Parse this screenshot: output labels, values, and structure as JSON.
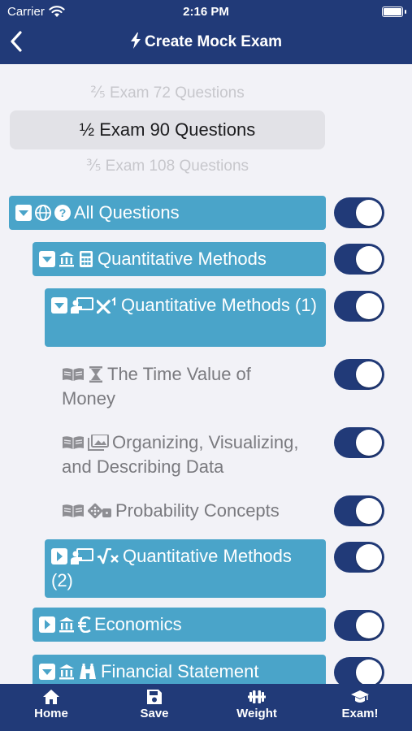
{
  "status": {
    "carrier": "Carrier",
    "time": "2:16 PM"
  },
  "header": {
    "title": "Create Mock Exam"
  },
  "picker": {
    "above": "⅖ Exam 72 Questions",
    "selected": "½ Exam 90 Questions",
    "below": "⅗ Exam 108 Questions"
  },
  "tree": [
    {
      "label": "All Questions",
      "expanded": true,
      "enabled": true
    },
    {
      "label": "Quantitative Methods",
      "expanded": true,
      "enabled": true
    },
    {
      "label": "Quantitative Methods (1)",
      "expanded": true,
      "enabled": true
    },
    {
      "label": "The Time Value of Money",
      "enabled": true
    },
    {
      "label": "Organizing, Visualizing, and Describing Data",
      "enabled": true
    },
    {
      "label": "Probability Concepts",
      "enabled": true
    },
    {
      "label": "Quantitative Methods (2)",
      "expanded": false,
      "enabled": true
    },
    {
      "label": "Economics",
      "expanded": false,
      "enabled": true
    },
    {
      "label": "Financial Statement",
      "expanded": true,
      "enabled": true
    }
  ],
  "tabs": [
    {
      "label": "Home",
      "icon": "home-icon"
    },
    {
      "label": "Save",
      "icon": "save-icon"
    },
    {
      "label": "Weight",
      "icon": "weight-icon"
    },
    {
      "label": "Exam!",
      "icon": "graduation-cap-icon"
    }
  ],
  "colors": {
    "navy": "#213a78",
    "teal": "#4aa4c9",
    "background": "#f2f2f7"
  }
}
